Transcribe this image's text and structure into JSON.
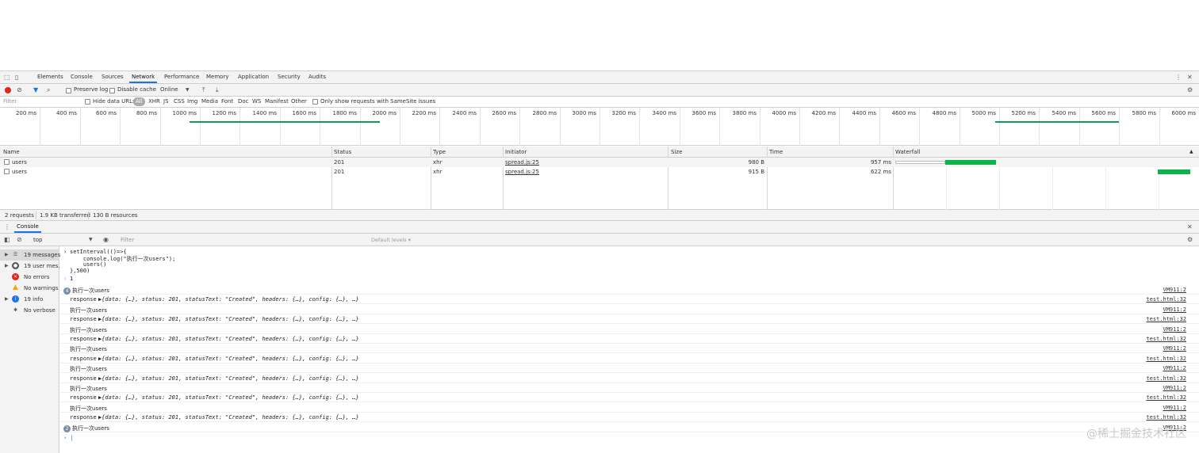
{
  "tabs": [
    "Elements",
    "Console",
    "Sources",
    "Network",
    "Performance",
    "Memory",
    "Application",
    "Security",
    "Audits"
  ],
  "active_tab": "Network",
  "network_toolbar": {
    "preserve_log": "Preserve log",
    "disable_cache": "Disable cache",
    "throttle": "Online"
  },
  "filter": {
    "placeholder": "Filter",
    "hide_data_urls": "Hide data URLs",
    "types": [
      "All",
      "XHR",
      "JS",
      "CSS",
      "Img",
      "Media",
      "Font",
      "Doc",
      "WS",
      "Manifest",
      "Other"
    ],
    "samesite": "Only show requests with SameSite issues"
  },
  "timeline_ticks": [
    "200 ms",
    "400 ms",
    "600 ms",
    "800 ms",
    "1000 ms",
    "1200 ms",
    "1400 ms",
    "1600 ms",
    "1800 ms",
    "2000 ms",
    "2200 ms",
    "2400 ms",
    "2600 ms",
    "2800 ms",
    "3000 ms",
    "3200 ms",
    "3400 ms",
    "3600 ms",
    "3800 ms",
    "4000 ms",
    "4200 ms",
    "4400 ms",
    "4600 ms",
    "4800 ms",
    "5000 ms",
    "5200 ms",
    "5400 ms",
    "5600 ms",
    "5800 ms",
    "6000 ms"
  ],
  "columns": {
    "name": "Name",
    "status": "Status",
    "type": "Type",
    "initiator": "Initiator",
    "size": "Size",
    "time": "Time",
    "waterfall": "Waterfall"
  },
  "requests": [
    {
      "name": "users",
      "status": "201",
      "type": "xhr",
      "initiator": "spread.js:25",
      "size": "980 B",
      "time": "957 ms"
    },
    {
      "name": "users",
      "status": "201",
      "type": "xhr",
      "initiator": "spread.js:25",
      "size": "915 B",
      "time": "622 ms"
    }
  ],
  "status_bar": {
    "requests": "2 requests",
    "transferred": "1.9 KB transferred",
    "resources": "130 B resources"
  },
  "drawer": {
    "tab": "Console",
    "context": "top",
    "filter_placeholder": "Filter",
    "levels": "Default levels ▾"
  },
  "sidebar": [
    {
      "label": "19 messages",
      "icon": "list-icon"
    },
    {
      "label": "19 user mes...",
      "icon": "user-icon"
    },
    {
      "label": "No errors",
      "icon": "error-icon"
    },
    {
      "label": "No warnings",
      "icon": "warning-icon"
    },
    {
      "label": "19 info",
      "icon": "info-icon"
    },
    {
      "label": "No verbose",
      "icon": "bug-icon"
    }
  ],
  "console": {
    "code": [
      "setInterval(()=>{",
      "    console.log(\"执行一次users\");",
      "    users()",
      "},500)"
    ],
    "result": "1",
    "first_log": "执行一次users",
    "first_count": "4",
    "log_text": "执行一次users",
    "response_label": "response",
    "response_obj": "{data: {…}, status: 201, statusText: \"Created\", headers: {…}, config: {…}, …}",
    "src_vm": "VM911:2",
    "src_test": "test.html:32",
    "last_count": "2",
    "last_log": "执行一次users"
  },
  "watermark": "@稀土掘金技术社区",
  "colors": {
    "accent": "#1a73e8",
    "bar": "#0cb34a",
    "record": "#e0251b"
  }
}
